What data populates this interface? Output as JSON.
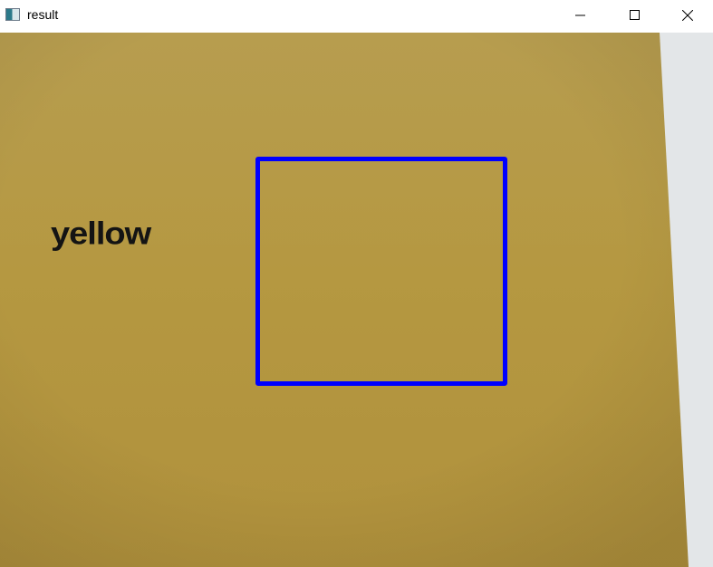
{
  "window": {
    "title": "result",
    "icon": "opencv-window-icon",
    "controls": {
      "minimize_icon": "minimize-icon",
      "maximize_icon": "maximize-icon",
      "close_icon": "close-icon"
    }
  },
  "detection": {
    "label": "yellow",
    "label_color": "#141414",
    "box_color": "#0000ff"
  },
  "scene_colors": {
    "background_top": "#b79d4f",
    "background_bottom": "#b0913c",
    "wall": "#e3e6e8"
  }
}
